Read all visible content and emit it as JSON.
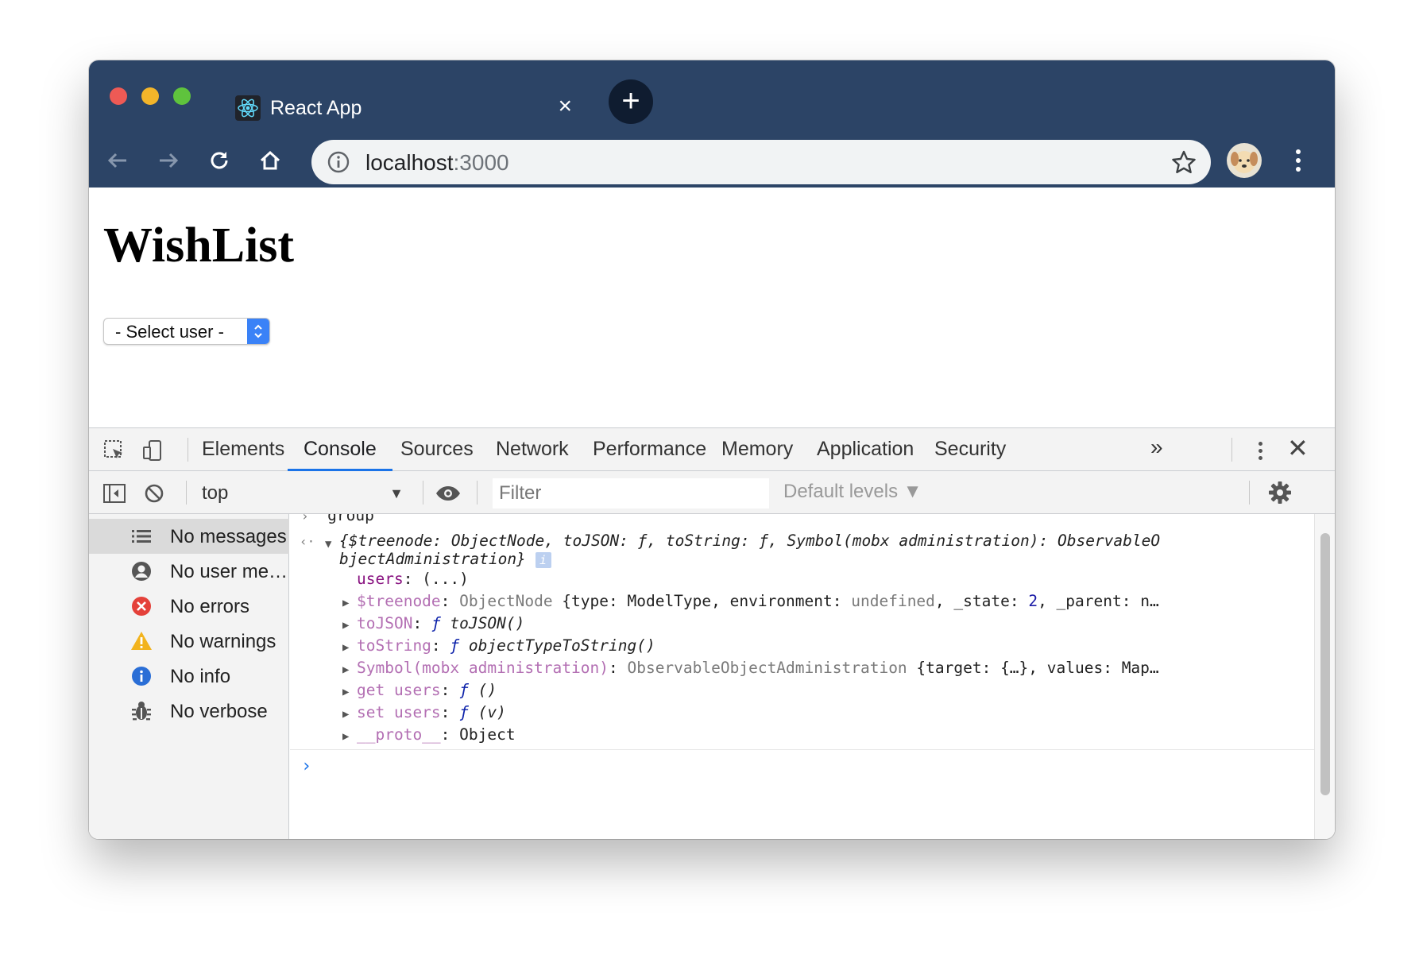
{
  "browser": {
    "tab_title": "React App",
    "tab_close_icon": "close-icon",
    "new_tab_label": "+",
    "url_host": "localhost",
    "url_port": ":3000",
    "colors": {
      "frame": "#2c4466",
      "omnibox": "#f1f3f4",
      "accent": "#1a73e8"
    }
  },
  "page": {
    "title": "WishList",
    "user_select": {
      "selected": "- Select user -"
    }
  },
  "devtools": {
    "tabs": [
      "Elements",
      "Console",
      "Sources",
      "Network",
      "Performance",
      "Memory",
      "Application",
      "Security"
    ],
    "active_tab": "Console",
    "more_tabs": "»",
    "context": "top",
    "filter_placeholder": "Filter",
    "levels": "Default levels ▼",
    "sidebar": [
      {
        "label": "No messages",
        "icon": "list-icon"
      },
      {
        "label": "No user messages",
        "icon": "user-icon"
      },
      {
        "label": "No errors",
        "icon": "error-icon"
      },
      {
        "label": "No warnings",
        "icon": "warning-icon"
      },
      {
        "label": "No info",
        "icon": "info-icon"
      },
      {
        "label": "No verbose",
        "icon": "bug-icon"
      }
    ],
    "console": {
      "group_label": "group",
      "summary": "{$treenode: ObjectNode, toJSON: ƒ, toString: ƒ, Symbol(mobx administration): ObservableO",
      "summary_wrap": "bjectAdministration}",
      "info_badge": "i",
      "users_line": {
        "key": "users",
        "value": ": (...)"
      },
      "props": [
        {
          "key": "$treenode",
          "sep": ": ",
          "type": "ObjectNode",
          "rest": " {type: ModelType, environment: ",
          "undef": "undefined",
          "rest2": ", _state: ",
          "num": "2",
          "rest3": ", _parent: n…"
        },
        {
          "key": "toJSON",
          "sep": ": ",
          "f": "ƒ",
          "fn": " toJSON()"
        },
        {
          "key": "toString",
          "sep": ": ",
          "f": "ƒ",
          "fn": " objectTypeToString()"
        },
        {
          "key": "Symbol(mobx administration)",
          "sep": ": ",
          "type": "ObservableObjectAdministration",
          "rest": " {target: {…}, values: Map…"
        },
        {
          "key": "get users",
          "sep": ": ",
          "f": "ƒ",
          "fn": " ()"
        },
        {
          "key": "set users",
          "sep": ": ",
          "f": "ƒ",
          "fn": " (v)"
        },
        {
          "key": "__proto__",
          "sep": ": ",
          "rest": "Object"
        }
      ],
      "prompt": "›"
    }
  }
}
